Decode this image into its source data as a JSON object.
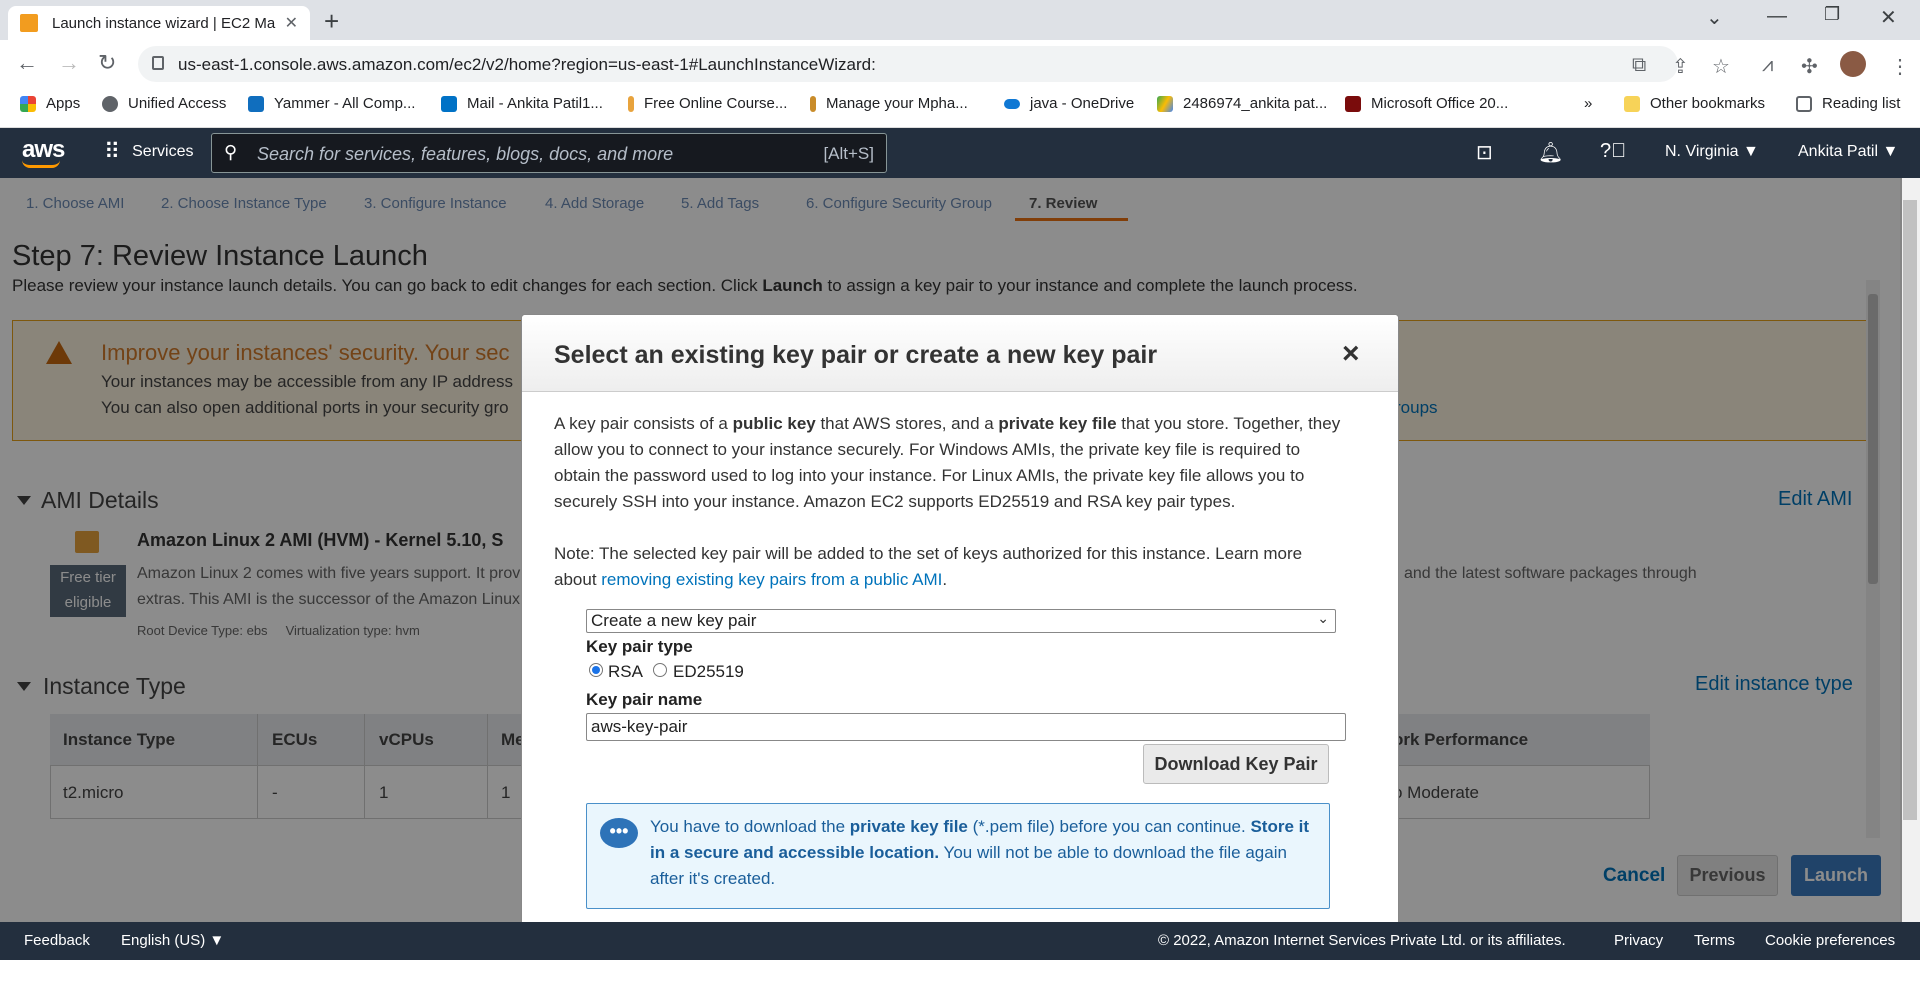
{
  "browser": {
    "tab_title": "Launch instance wizard | EC2 Ma",
    "url": "us-east-1.console.aws.amazon.com/ec2/v2/home?region=us-east-1#LaunchInstanceWizard:",
    "bookmarks": [
      "Apps",
      "Unified Access",
      "Yammer - All Comp...",
      "Mail - Ankita Patil1...",
      "Free Online Course...",
      "Manage your Mpha...",
      "java - OneDrive",
      "2486974_ankita pat...",
      "Microsoft Office 20..."
    ],
    "more_bookmarks": "»",
    "other_bookmarks": "Other bookmarks",
    "reading_list": "Reading list"
  },
  "aws_nav": {
    "logo": "aws",
    "services": "Services",
    "search_placeholder": "Search for services, features, blogs, docs, and more",
    "search_shortcut": "[Alt+S]",
    "region": "N. Virginia ▼",
    "user": "Ankita Patil ▼"
  },
  "wizard": {
    "tabs": [
      "1. Choose AMI",
      "2. Choose Instance Type",
      "3. Configure Instance",
      "4. Add Storage",
      "5. Add Tags",
      "6. Configure Security Group",
      "7. Review"
    ],
    "active_tab_index": 6,
    "title": "Step 7: Review Instance Launch",
    "description_pre": "Please review your instance launch details. You can go back to edit changes for each section. Click ",
    "description_bold": "Launch",
    "description_post": " to assign a key pair to your instance and complete the launch process."
  },
  "warning": {
    "title": "Improve your instances' security. Your sec",
    "line1": "Your instances may be accessible from any IP address",
    "line2": "You can also open additional ports in your security gro",
    "link": "roups"
  },
  "ami_details": {
    "heading": "AMI Details",
    "edit": "Edit AMI",
    "name": "Amazon Linux 2 AMI (HVM) - Kernel 5.10, S",
    "badge_line1": "Free tier",
    "badge_line2": "eligible",
    "desc1": "Amazon Linux 2 comes with five years support. It prov",
    "desc1_right": "and the latest software packages through",
    "desc2": "extras. This AMI is the successor of the Amazon Linux",
    "meta": "Root Device Type: ebs     Virtualization type: hvm"
  },
  "instance_type": {
    "heading": "Instance Type",
    "edit": "Edit instance type",
    "headers": [
      "Instance Type",
      "ECUs",
      "vCPUs",
      "Me",
      "ork Performance"
    ],
    "row": [
      "t2.micro",
      "-",
      "1",
      "1",
      "o Moderate"
    ]
  },
  "page_actions": {
    "cancel": "Cancel",
    "previous": "Previous",
    "launch": "Launch"
  },
  "modal": {
    "title": "Select an existing key pair or create a new key pair",
    "close": "×",
    "p1_a": "A key pair consists of a ",
    "p1_b": "public key",
    "p1_c": " that AWS stores, and a ",
    "p1_d": "private key file",
    "p1_e": " that you store. Together, they",
    "p1_line2": "allow you to connect to your instance securely. For Windows AMIs, the private key file is required to",
    "p1_line3": "obtain the password used to log into your instance. For Linux AMIs, the private key file allows you to",
    "p1_line4": "securely SSH into your instance. Amazon EC2 supports ED25519 and RSA key pair types.",
    "note_line1": "Note: The selected key pair will be added to the set of keys authorized for this instance. Learn more",
    "note_about": "about ",
    "note_link": "removing existing key pairs from a public AMI",
    "note_end": ".",
    "select_value": "Create a new key pair",
    "key_type_label": "Key pair type",
    "radio_rsa": "RSA",
    "radio_ed": "ED25519",
    "key_name_label": "Key pair name",
    "key_name_value": "aws-key-pair",
    "download": "Download Key Pair",
    "info_a": "You have to download the ",
    "info_b": "private key file",
    "info_c": " (*.pem file) before you can continue. ",
    "info_d": "Store it in a secure and accessible location.",
    "info_e": " You will not be able to download the file again after it's created."
  },
  "footer": {
    "feedback": "Feedback",
    "language": "English (US) ▼",
    "copyright": "© 2022, Amazon Internet Services Private Ltd. or its affiliates.",
    "privacy": "Privacy",
    "terms": "Terms",
    "cookies": "Cookie preferences"
  }
}
